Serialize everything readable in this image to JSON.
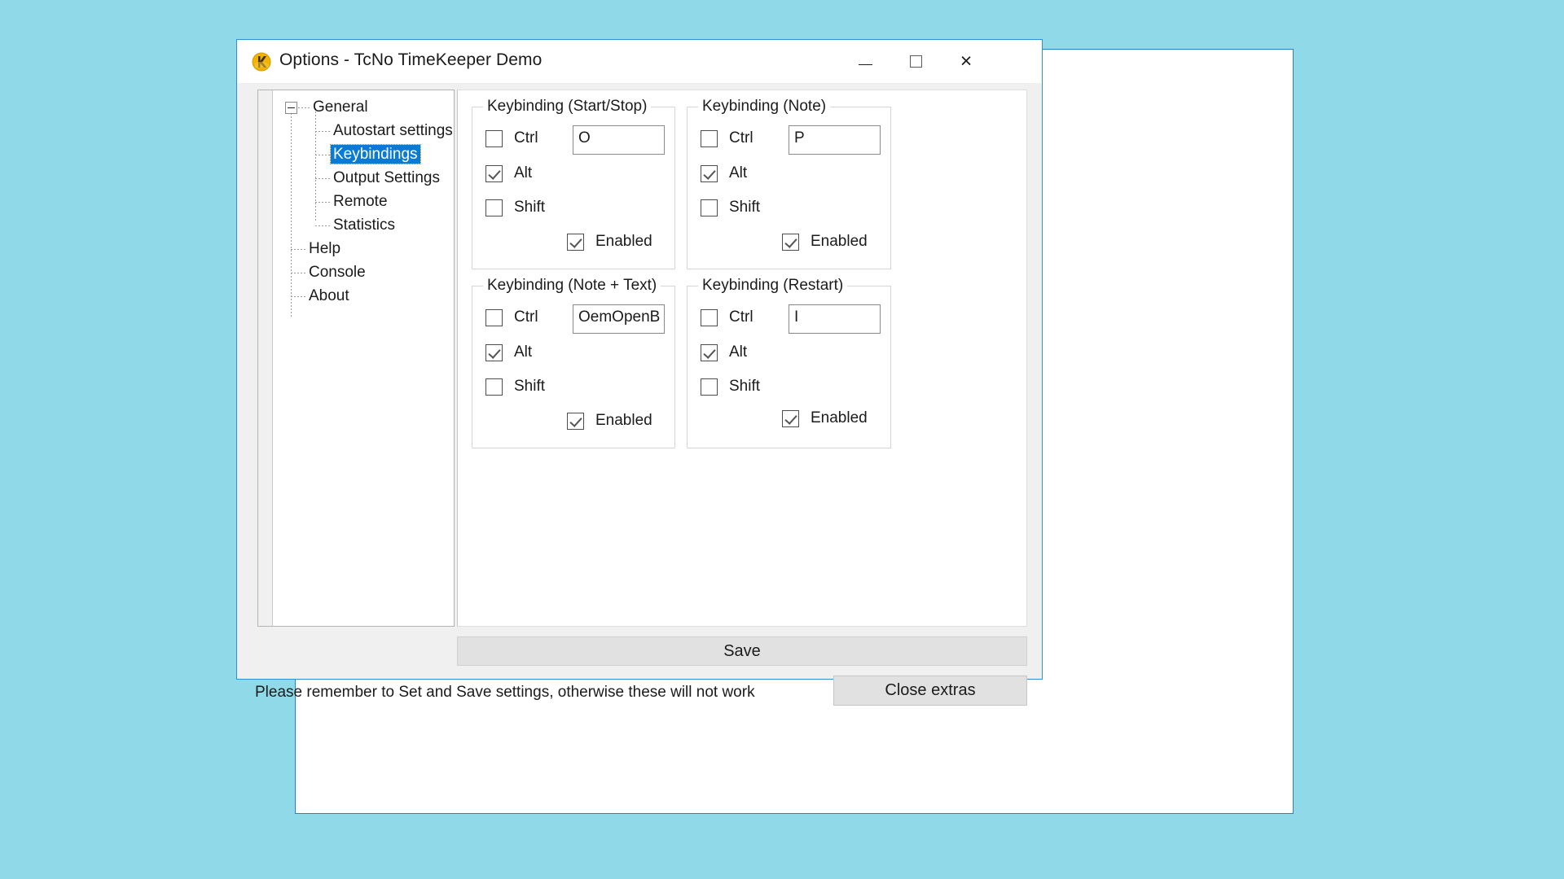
{
  "window": {
    "title": "Options - TcNo TimeKeeper Demo",
    "icon": "app-logo-icon",
    "minimize_label": "",
    "maximize_label": "",
    "close_label": "×",
    "accent_color": "#2f8fd8",
    "desktop_background": "#8fd9e8"
  },
  "tree": {
    "nodes": [
      {
        "label": "General",
        "level": 0,
        "expander": "minus",
        "selected": false
      },
      {
        "label": "Autostart settings",
        "level": 1,
        "selected": false
      },
      {
        "label": "Keybindings",
        "level": 1,
        "selected": true
      },
      {
        "label": "Output Settings",
        "level": 1,
        "selected": false
      },
      {
        "label": "Remote",
        "level": 1,
        "selected": false
      },
      {
        "label": "Statistics",
        "level": 1,
        "selected": false
      },
      {
        "label": "Help",
        "level": 0,
        "selected": false
      },
      {
        "label": "Console",
        "level": 0,
        "selected": false
      },
      {
        "label": "About",
        "level": 0,
        "selected": false
      }
    ],
    "selection_color": "#0a7bd4"
  },
  "groups": [
    {
      "id": "start_stop",
      "title": "Keybinding (Start/Stop)",
      "ctrl_label": "Ctrl",
      "alt_label": "Alt",
      "shift_label": "Shift",
      "enabled_label": "Enabled",
      "ctrl_checked": false,
      "alt_checked": true,
      "shift_checked": false,
      "enabled_checked": true,
      "key_value": "O"
    },
    {
      "id": "note",
      "title": "Keybinding (Note)",
      "ctrl_label": "Ctrl",
      "alt_label": "Alt",
      "shift_label": "Shift",
      "enabled_label": "Enabled",
      "ctrl_checked": false,
      "alt_checked": true,
      "shift_checked": false,
      "enabled_checked": true,
      "key_value": "P"
    },
    {
      "id": "note_text",
      "title": "Keybinding (Note + Text)",
      "ctrl_label": "Ctrl",
      "alt_label": "Alt",
      "shift_label": "Shift",
      "enabled_label": "Enabled",
      "ctrl_checked": false,
      "alt_checked": true,
      "shift_checked": false,
      "enabled_checked": true,
      "key_value": "OemOpenB"
    },
    {
      "id": "restart",
      "title": "Keybinding (Restart)",
      "ctrl_label": "Ctrl",
      "alt_label": "Alt",
      "shift_label": "Shift",
      "enabled_label": "Enabled",
      "ctrl_checked": false,
      "alt_checked": true,
      "shift_checked": false,
      "enabled_checked": true,
      "key_value": "I"
    }
  ],
  "footer": {
    "save_label": "Save",
    "status_text": "Please remember to Set and Save settings, otherwise these will not work",
    "close_extras_label": "Close extras"
  }
}
